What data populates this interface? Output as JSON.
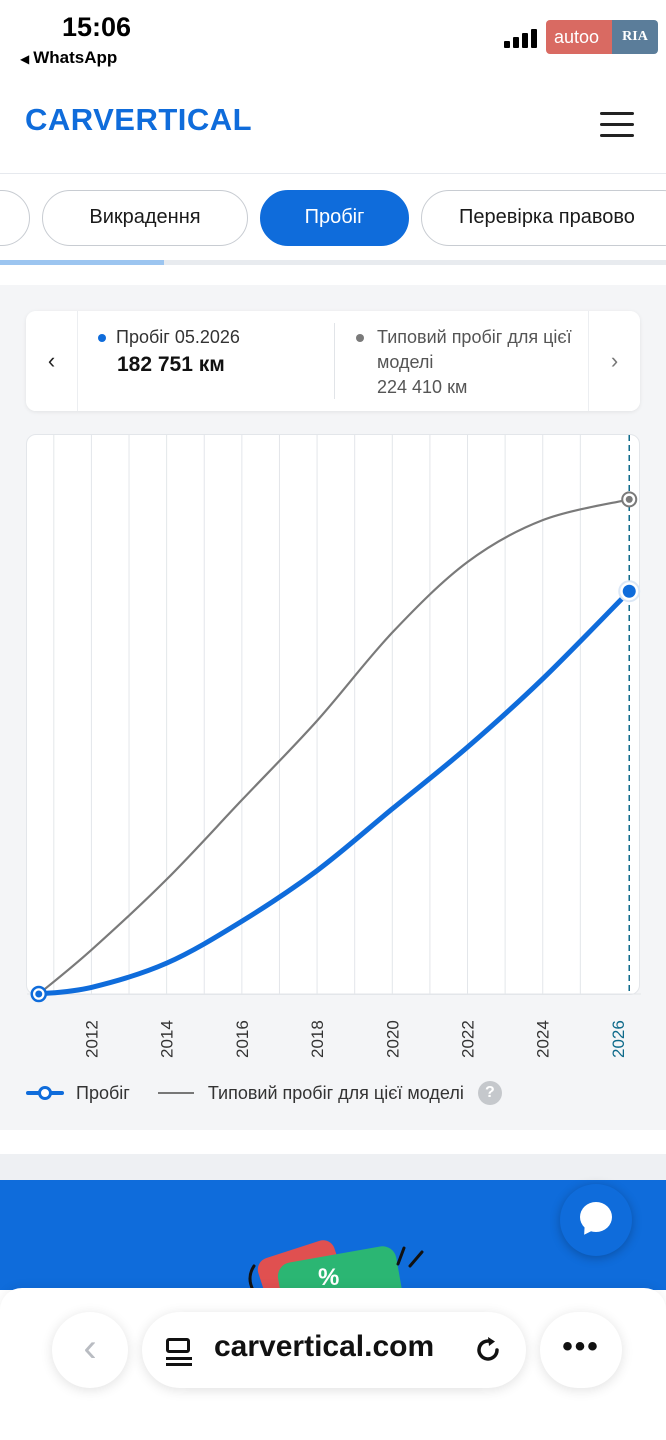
{
  "status_bar": {
    "time": "15:06",
    "back_app": "WhatsApp",
    "watermark_left": "autoo",
    "watermark_right": "RIA"
  },
  "header": {
    "logo": "CARVERTICAL",
    "menu_icon": "hamburger-icon"
  },
  "tabs": [
    {
      "label": "",
      "active": false
    },
    {
      "label": "Викрадення",
      "active": false
    },
    {
      "label": "Пробіг",
      "active": true
    },
    {
      "label": "Перевірка правово",
      "active": false
    }
  ],
  "summary": {
    "mileage_label": "Пробіг 05.2026",
    "mileage_value": "182 751 км",
    "typical_label": "Типовий пробіг для цієї моделі",
    "typical_value": "224 410 км",
    "prev_icon": "chevron-left-icon",
    "next_icon": "chevron-right-icon"
  },
  "legend": {
    "mileage": "Пробіг",
    "typical": "Типовий пробіг для цієї моделі",
    "help": "?"
  },
  "colors": {
    "accent": "#0f6cdb",
    "typical_line": "#7a7a7a",
    "grid": "#e3e6ea"
  },
  "chart_data": {
    "type": "line",
    "x_ticks": [
      "2012",
      "2014",
      "2016",
      "2018",
      "2020",
      "2022",
      "2024",
      "2026"
    ],
    "xlim": [
      2010.5,
      2026.4
    ],
    "ylim": [
      0,
      250000
    ],
    "current_marker": "2026",
    "series": [
      {
        "name": "Пробіг",
        "color": "#0f6cdb",
        "x": [
          2010.6,
          2012,
          2014,
          2016,
          2018,
          2020,
          2022,
          2024,
          2026.3
        ],
        "y": [
          0,
          3000,
          14000,
          33000,
          56000,
          84000,
          112000,
          143000,
          182751
        ]
      },
      {
        "name": "Типовий пробіг для цієї моделі",
        "color": "#7a7a7a",
        "x": [
          2010.6,
          2012,
          2014,
          2016,
          2018,
          2020,
          2022,
          2024,
          2026.3
        ],
        "y": [
          0,
          20000,
          52000,
          88000,
          124000,
          164000,
          196000,
          215000,
          224410
        ]
      }
    ]
  },
  "promo": {
    "percent": "%",
    "chat_icon": "chat-bubble-icon"
  },
  "browser": {
    "back_icon": "chevron-left-icon",
    "url": "carvertical.com",
    "tabs_icon": "tab-overview-icon",
    "reload_icon": "reload-icon",
    "more": "•••"
  }
}
